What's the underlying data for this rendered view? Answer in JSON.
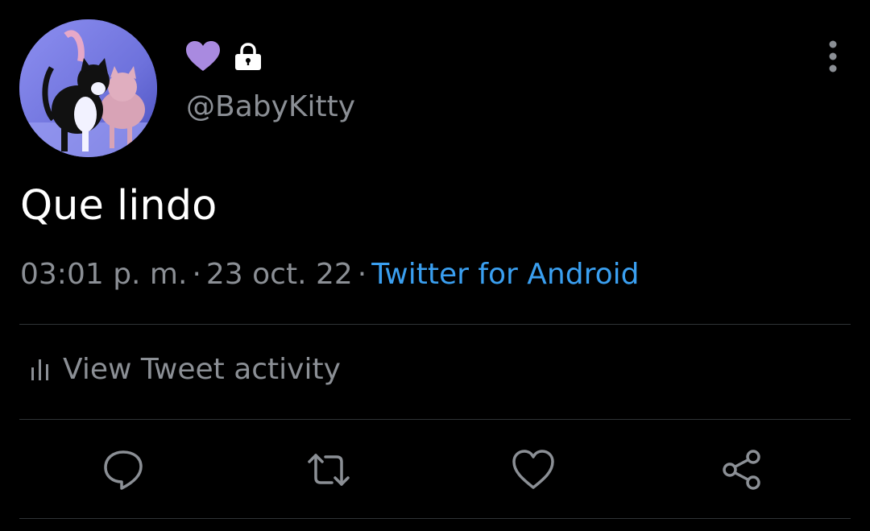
{
  "tweet": {
    "handle": "@BabyKitty",
    "text": "Que lindo",
    "time": "03:01 p. m.",
    "date": "23 oct. 22",
    "separator": "·",
    "source": "Twitter for Android"
  },
  "activity": {
    "label": "View Tweet activity",
    "icon": "bar-chart-icon"
  },
  "header_icons": {
    "heart": "purple-heart-icon",
    "lock": "lock-icon",
    "more": "more-vertical-icon"
  },
  "actions": [
    {
      "icon": "reply-icon"
    },
    {
      "icon": "retweet-icon"
    },
    {
      "icon": "like-icon"
    },
    {
      "icon": "share-icon"
    }
  ],
  "colors": {
    "background": "#000000",
    "text_primary": "#ffffff",
    "text_secondary": "#8b8f95",
    "link": "#3a9ff0",
    "heart_purple": "#a98ae0",
    "divider": "#2f3336"
  }
}
